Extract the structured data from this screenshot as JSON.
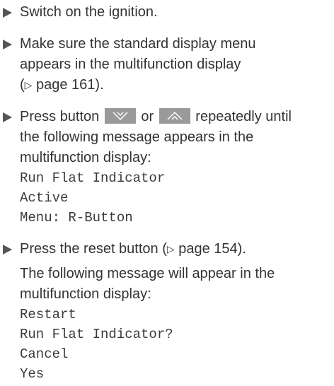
{
  "steps": [
    {
      "text": "Switch on the ignition."
    },
    {
      "line1": "Make sure the standard display menu",
      "line2": "appears in the multifunction display",
      "ref_open": "(",
      "ref_arrow": "▷",
      "ref_text": " page 161).",
      "ref_close": ""
    },
    {
      "press": "Press button ",
      "or": " or ",
      "after": " repeatedly until",
      "line2": "the following message appears in the",
      "line3": "multifunction display:",
      "key_down_icon": "chevron-down-outline-icon",
      "key_up_icon": "chevron-up-outline-icon",
      "message": [
        "Run Flat Indicator",
        "Active",
        "Menu: R-Button"
      ]
    },
    {
      "before": "Press the reset button (",
      "ref_arrow": "▷",
      "after": " page 154).",
      "result_line1": "The following message will appear in the",
      "result_line2": "multifunction display:",
      "message": [
        "Restart",
        "Run Flat Indicator?",
        "Cancel",
        "Yes"
      ]
    }
  ],
  "colors": {
    "text": "#333333",
    "bullet": "#555555",
    "key_background": "#9a9a9a",
    "key_symbol": "#ffffff"
  }
}
